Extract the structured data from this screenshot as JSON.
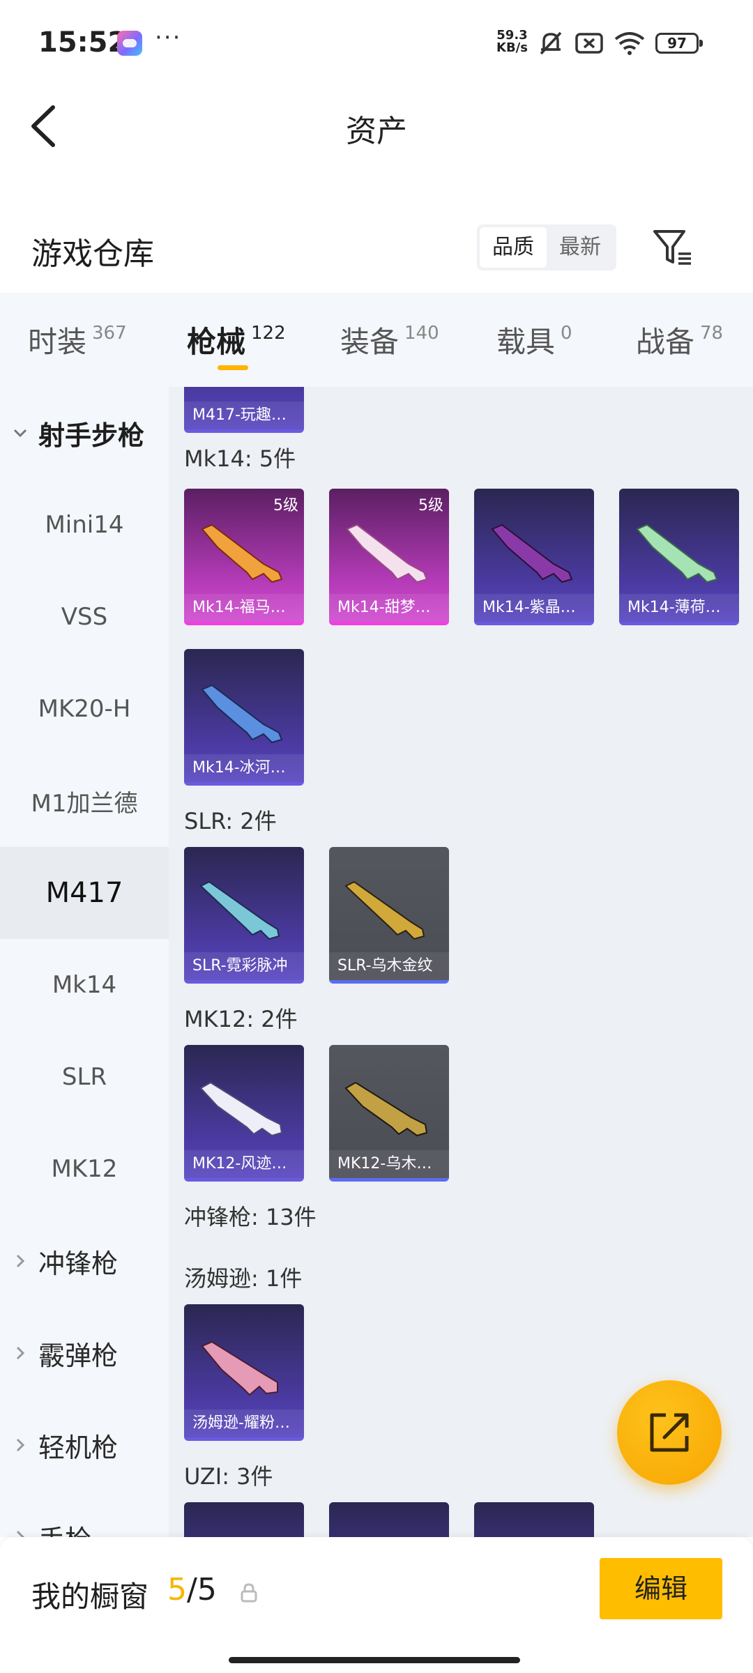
{
  "status_bar": {
    "time": "15:52",
    "net_speed_value": "59.3",
    "net_speed_unit": "KB/s",
    "battery": "97",
    "icons": [
      "game-app-icon",
      "mute-icon",
      "sim-icon",
      "wifi-icon",
      "battery-icon"
    ]
  },
  "header": {
    "title": "资产"
  },
  "warehouse": {
    "title": "游戏仓库",
    "sort_options": [
      "品质",
      "最新"
    ],
    "sort_selected": "品质"
  },
  "tabs": [
    {
      "label": "时装",
      "count": "367",
      "active": false
    },
    {
      "label": "枪械",
      "count": "122",
      "active": true
    },
    {
      "label": "装备",
      "count": "140",
      "active": false
    },
    {
      "label": "载具",
      "count": "0",
      "active": false
    },
    {
      "label": "战备",
      "count": "78",
      "active": false
    }
  ],
  "sidenav": {
    "items": [
      {
        "label": "射手步枪",
        "type": "group",
        "expanded": true
      },
      {
        "label": "Mini14",
        "type": "item"
      },
      {
        "label": "VSS",
        "type": "item"
      },
      {
        "label": "MK20-H",
        "type": "item"
      },
      {
        "label": "M1加兰德",
        "type": "item"
      },
      {
        "label": "M417",
        "type": "item",
        "active": true
      },
      {
        "label": "Mk14",
        "type": "item"
      },
      {
        "label": "SLR",
        "type": "item"
      },
      {
        "label": "MK12",
        "type": "item"
      },
      {
        "label": "冲锋枪",
        "type": "group"
      },
      {
        "label": "霰弹枪",
        "type": "group"
      },
      {
        "label": "轻机枪",
        "type": "group"
      },
      {
        "label": "手枪",
        "type": "group"
      }
    ]
  },
  "content": {
    "partial_top_card": {
      "name": "M417-玩趣…"
    },
    "sections": {
      "mk14": {
        "label": "Mk14: 5件",
        "items": [
          {
            "name": "Mk14-福马…",
            "level": "5级",
            "rarity": "pink"
          },
          {
            "name": "Mk14-甜梦…",
            "level": "5级",
            "rarity": "pink"
          },
          {
            "name": "Mk14-紫晶…",
            "rarity": "purple"
          },
          {
            "name": "Mk14-薄荷…",
            "rarity": "purple"
          },
          {
            "name": "Mk14-冰河…",
            "rarity": "purple"
          }
        ]
      },
      "slr": {
        "label": "SLR: 2件",
        "items": [
          {
            "name": "SLR-霓彩脉冲",
            "rarity": "purple"
          },
          {
            "name": "SLR-乌木金纹",
            "rarity": "gray"
          }
        ]
      },
      "mk12": {
        "label": "MK12: 2件",
        "items": [
          {
            "name": "MK12-风迹…",
            "rarity": "purple"
          },
          {
            "name": "MK12-乌木…",
            "rarity": "gray"
          }
        ]
      },
      "smg_header": {
        "label": "冲锋枪: 13件"
      },
      "thompson": {
        "label": "汤姆逊: 1件",
        "items": [
          {
            "name": "汤姆逊-耀粉…",
            "rarity": "purple"
          }
        ]
      },
      "uzi": {
        "label": "UZI: 3件"
      }
    }
  },
  "bottom_bar": {
    "label": "我的橱窗",
    "count_current": "5",
    "count_sep_total": "/5",
    "edit_label": "编辑"
  },
  "colors": {
    "accent": "#ffbd00",
    "pink_rarity": "#d04bd0",
    "purple_rarity": "#5846c0",
    "gray_rarity": "#4b4d55"
  }
}
